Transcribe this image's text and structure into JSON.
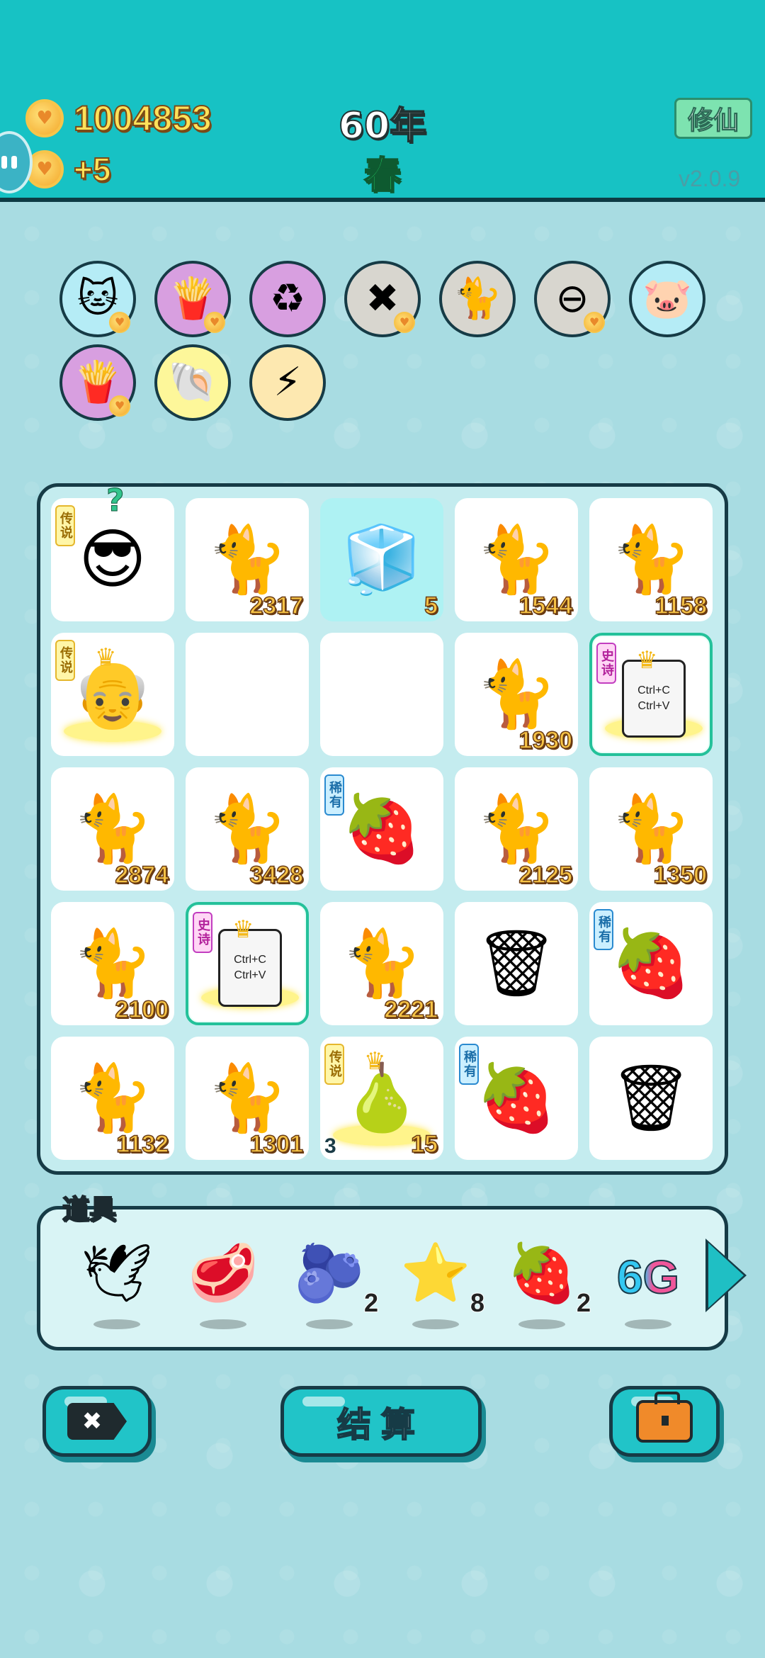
{
  "header": {
    "money": "1004853",
    "income": "+5",
    "year": "60年",
    "season": "春",
    "mode_button": "修仙",
    "version": "v2.0.9"
  },
  "buffs": [
    {
      "name": "cat-silhouette-buff",
      "glyph": "🐱",
      "bg": "#b5ecf6",
      "heart": true
    },
    {
      "name": "fries-buff",
      "glyph": "🍟",
      "bg": "#d89fe0",
      "heart": true
    },
    {
      "name": "recycle-buff",
      "glyph": "♻",
      "bg": "#d89fe0",
      "heart": false
    },
    {
      "name": "delete-tag-buff",
      "glyph": "✖",
      "bg": "#d8d6cf",
      "heart": true
    },
    {
      "name": "twin-cats-buff",
      "glyph": "🐈",
      "bg": "#d8d6cf",
      "heart": false
    },
    {
      "name": "minus-buff",
      "glyph": "⊖",
      "bg": "#d8d6cf",
      "heart": true
    },
    {
      "name": "piggy-bank-buff",
      "glyph": "🐷",
      "bg": "#b5ecf6",
      "heart": false
    },
    {
      "name": "fries-buff-2",
      "glyph": "🍟",
      "bg": "#d89fe0",
      "heart": true
    },
    {
      "name": "shell-buff",
      "glyph": "🐚",
      "bg": "#fdf79a",
      "heart": false
    },
    {
      "name": "lightning-buff",
      "glyph": "⚡",
      "bg": "#fde8b0",
      "heart": false
    }
  ],
  "grid": [
    {
      "kind": "person",
      "glyph": "😎",
      "tag": "传说",
      "tagType": "legend",
      "question": "?",
      "num": ""
    },
    {
      "kind": "cat",
      "glyph": "🐈",
      "num": "2317"
    },
    {
      "kind": "fridge",
      "glyph": "🧊",
      "num": "5",
      "teal": true
    },
    {
      "kind": "cat",
      "glyph": "🐈",
      "num": "1544"
    },
    {
      "kind": "cat",
      "glyph": "🐈",
      "num": "1158"
    },
    {
      "kind": "king",
      "glyph": "👴",
      "tag": "传说",
      "tagType": "legend",
      "num": ""
    },
    {
      "kind": "empty",
      "glyph": "",
      "num": ""
    },
    {
      "kind": "empty",
      "glyph": "",
      "num": ""
    },
    {
      "kind": "cat",
      "glyph": "🐈",
      "num": "1930"
    },
    {
      "kind": "copy",
      "tag": "史诗",
      "tagType": "epic",
      "line1": "Ctrl+C",
      "line2": "Ctrl+V",
      "selected": true,
      "num": ""
    },
    {
      "kind": "cat",
      "glyph": "🐈",
      "num": "2874"
    },
    {
      "kind": "cat",
      "glyph": "🐈",
      "num": "3428"
    },
    {
      "kind": "lychee",
      "glyph": "🍓",
      "tag": "稀有",
      "tagType": "rare",
      "num": ""
    },
    {
      "kind": "cat",
      "glyph": "🐈",
      "num": "2125"
    },
    {
      "kind": "cat",
      "glyph": "🐈",
      "num": "1350"
    },
    {
      "kind": "cat",
      "glyph": "🐈",
      "num": "2100"
    },
    {
      "kind": "copy",
      "tag": "史诗",
      "tagType": "epic",
      "line1": "Ctrl+C",
      "line2": "Ctrl+V",
      "selected": true,
      "num": ""
    },
    {
      "kind": "cat",
      "glyph": "🐈",
      "num": "2221"
    },
    {
      "kind": "trash",
      "glyph": "🗑",
      "num": ""
    },
    {
      "kind": "lychee",
      "glyph": "🍓",
      "tag": "稀有",
      "tagType": "rare",
      "num": ""
    },
    {
      "kind": "cat",
      "glyph": "🐈",
      "num": "1132"
    },
    {
      "kind": "cat",
      "glyph": "🐈",
      "num": "1301"
    },
    {
      "kind": "pear",
      "glyph": "🍐",
      "tag": "传说",
      "tagType": "legend",
      "numLeft": "3",
      "num": "15"
    },
    {
      "kind": "lychee",
      "glyph": "🍓",
      "tag": "稀有",
      "tagType": "rare",
      "num": ""
    },
    {
      "kind": "trash",
      "glyph": "🗑",
      "num": ""
    }
  ],
  "items": {
    "title": "道具",
    "list": [
      {
        "name": "dove-item",
        "glyph": "🕊",
        "count": ""
      },
      {
        "name": "liver-item",
        "glyph": "🥩",
        "count": ""
      },
      {
        "name": "bayberry-item",
        "glyph": "🫐",
        "count": "2"
      },
      {
        "name": "star-item",
        "glyph": "⭐",
        "count": "8"
      },
      {
        "name": "strawberry-item",
        "glyph": "🍓",
        "count": "2"
      },
      {
        "name": "6g-item",
        "text": "6G",
        "count": ""
      }
    ]
  },
  "buttons": {
    "settle_label": "结算"
  }
}
